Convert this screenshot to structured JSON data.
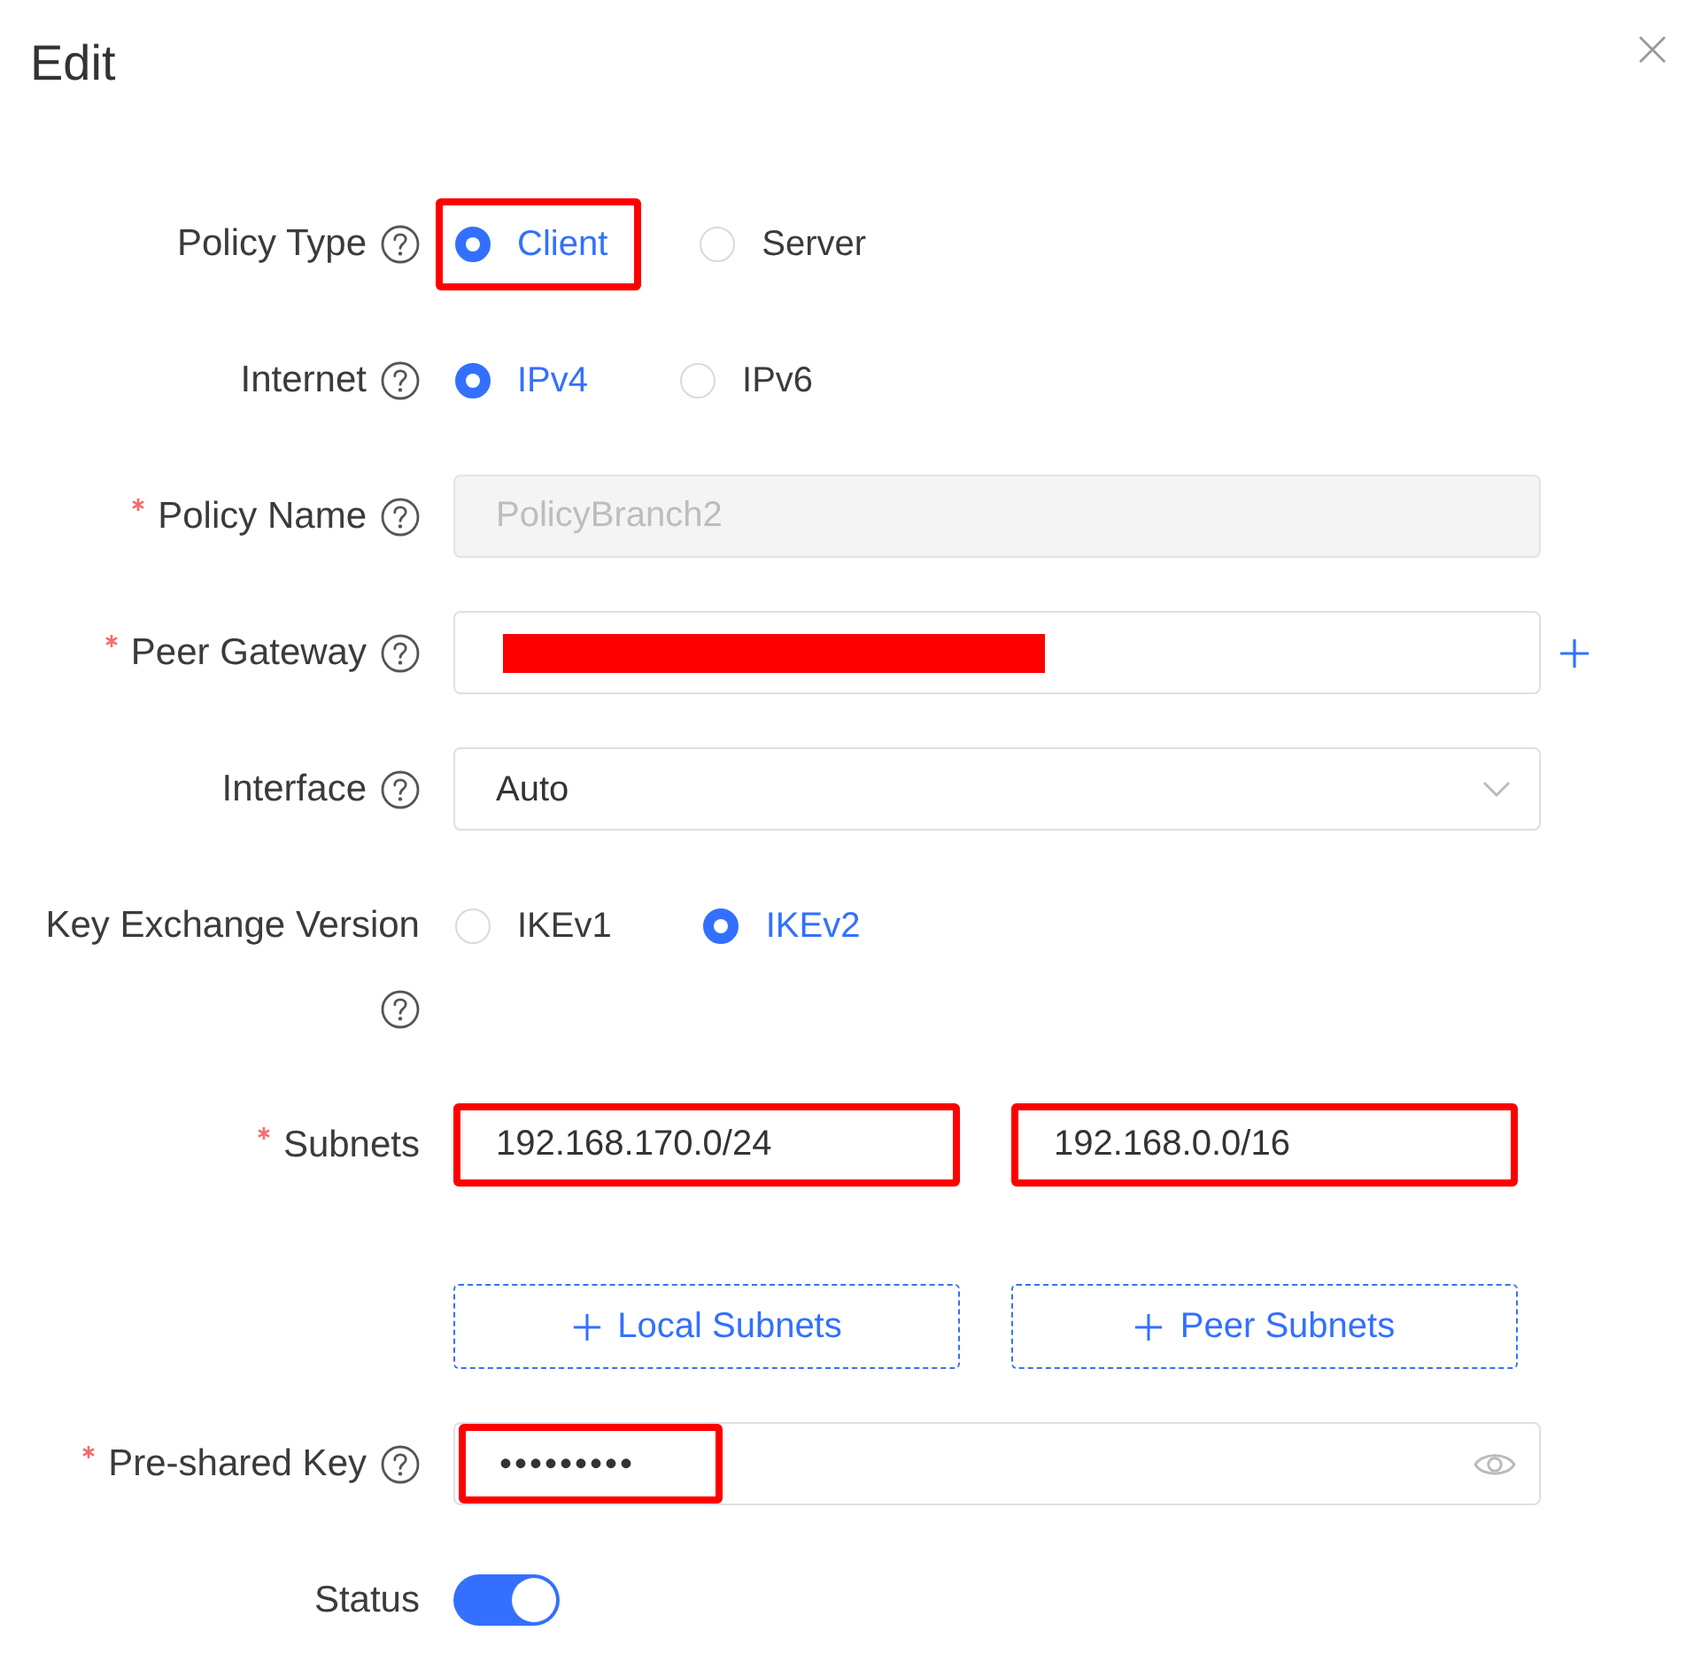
{
  "dialog": {
    "title": "Edit"
  },
  "fields": [
    {
      "kind": "radio",
      "label": "Policy Type",
      "required": false,
      "help": true,
      "options": [
        {
          "label": "Client",
          "selected": true,
          "highlighted": true
        },
        {
          "label": "Server",
          "selected": false,
          "highlighted": false
        }
      ]
    },
    {
      "kind": "radio",
      "label": "Internet",
      "required": false,
      "help": true,
      "options": [
        {
          "label": "IPv4",
          "selected": true,
          "highlighted": false
        },
        {
          "label": "IPv6",
          "selected": false,
          "highlighted": false
        }
      ]
    },
    {
      "kind": "text",
      "label": "Policy Name",
      "required": true,
      "help": true,
      "value": "PolicyBranch2",
      "disabled": true
    },
    {
      "kind": "text",
      "label": "Peer Gateway",
      "required": true,
      "help": true,
      "disabled": false,
      "redacted": true,
      "add_button": true
    },
    {
      "kind": "select",
      "label": "Interface",
      "required": false,
      "help": true,
      "value": "Auto"
    },
    {
      "kind": "radio",
      "label": "Key Exchange Version",
      "required": false,
      "help": true,
      "options": [
        {
          "label": "IKEv1",
          "selected": false,
          "highlighted": false
        },
        {
          "label": "IKEv2",
          "selected": true,
          "highlighted": false
        }
      ]
    },
    {
      "kind": "subnets",
      "label": "Subnets",
      "required": true,
      "help": false,
      "columns": [
        {
          "value": "192.168.170.0/24",
          "highlighted": true,
          "button": "Local Subnets"
        },
        {
          "value": "192.168.0.0/16",
          "highlighted": true,
          "button": "Peer Subnets"
        }
      ]
    },
    {
      "kind": "password",
      "label": "Pre-shared Key",
      "required": true,
      "help": true,
      "value": "•••••••••",
      "highlighted": true
    },
    {
      "kind": "switch",
      "label": "Status",
      "required": false,
      "help": false,
      "on": true
    }
  ]
}
